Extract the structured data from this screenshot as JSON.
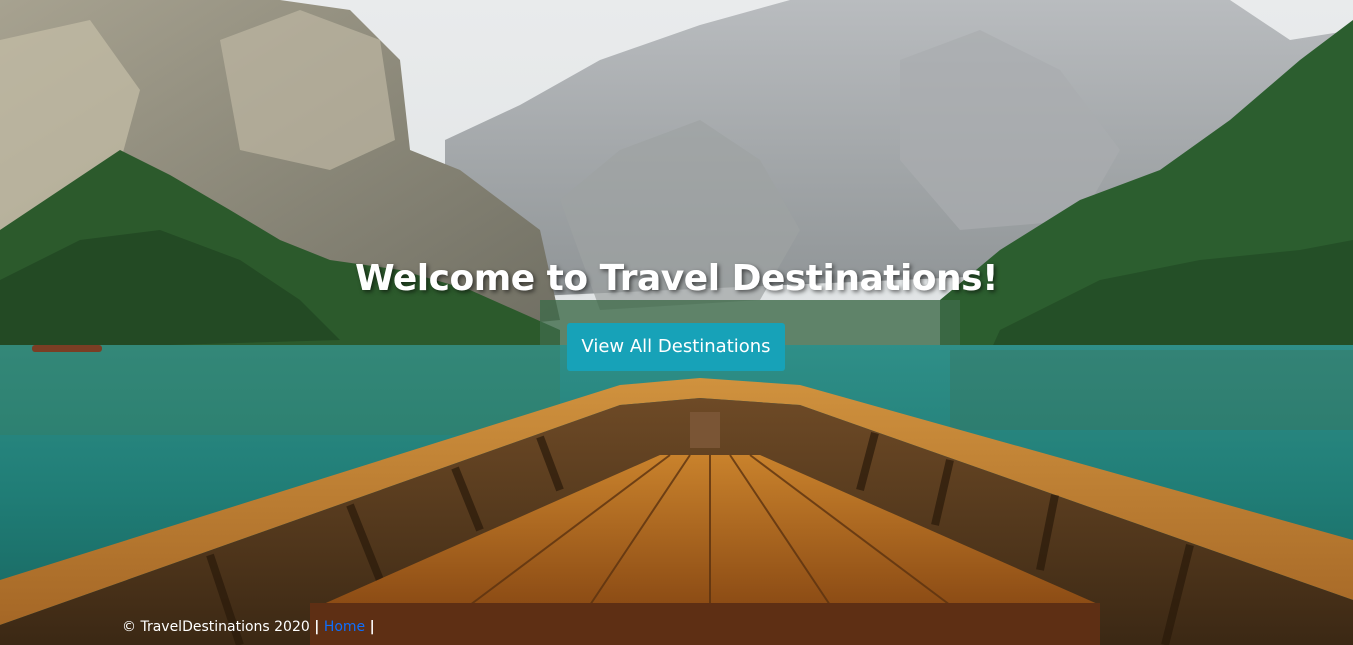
{
  "hero": {
    "title": "Welcome to Travel Destinations!",
    "button_label": "View All Destinations"
  },
  "footer": {
    "copyright": "© TravelDestinations 2020",
    "separator": "|",
    "home_link": "Home"
  },
  "colors": {
    "button_bg": "#17a2b8",
    "link": "#0d6efd",
    "text": "#ffffff"
  }
}
